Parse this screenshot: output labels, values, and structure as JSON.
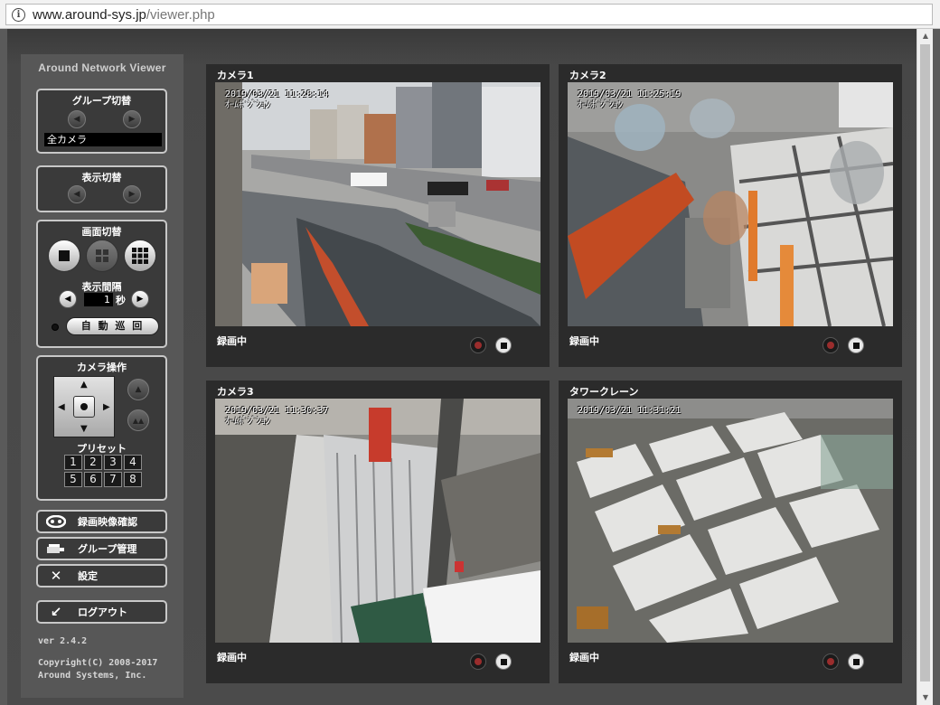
{
  "browser": {
    "url_domain": "www.around-sys.jp",
    "url_path": "/viewer.php"
  },
  "sidebar": {
    "app_title": "Around Network Viewer",
    "group_switch": {
      "title": "グループ切替",
      "current_group": "全カメラ"
    },
    "display_switch": {
      "title": "表示切替"
    },
    "screen_switch": {
      "title": "画面切替",
      "interval_label": "表示間隔",
      "interval_value": "1",
      "interval_unit": "秒",
      "auto_cycle_label": "自 動 巡 回"
    },
    "camera_control": {
      "title": "カメラ操作",
      "preset_label": "プリセット",
      "presets": [
        "1",
        "2",
        "3",
        "4",
        "5",
        "6",
        "7",
        "8"
      ]
    },
    "menu": {
      "recorded_video": "録画映像確認",
      "group_manage": "グループ管理",
      "settings": "設定",
      "logout": "ログアウト"
    },
    "version": "ver 2.4.2",
    "copyright_line1": "Copyright(C) 2008-2017",
    "copyright_line2": "Around Systems, Inc."
  },
  "cameras": [
    {
      "name": "カメラ1",
      "timestamp": "2019/03/21  11:28:14",
      "sub": "ｵｰﾑﾎﾟｼﾞｼｮﾝ",
      "status": "録画中"
    },
    {
      "name": "カメラ2",
      "timestamp": "2019/03/21  11:25:19",
      "sub": "ｵｰﾑﾎﾟｼﾞｼｮﾝ",
      "status": "録画中"
    },
    {
      "name": "カメラ3",
      "timestamp": "2019/03/21  11:30:37",
      "sub": "ｵｰﾑﾎﾟｼﾞｼｮﾝ",
      "status": "録画中"
    },
    {
      "name": "タワークレーン",
      "timestamp": "2019/03/21  11:31:21",
      "sub": "",
      "status": "録画中"
    }
  ]
}
